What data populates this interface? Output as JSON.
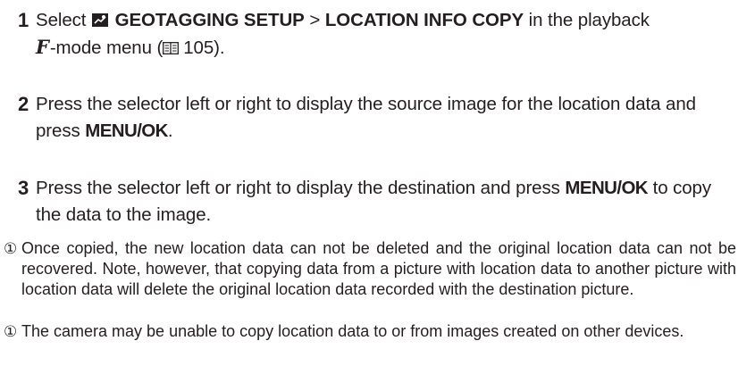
{
  "steps": [
    {
      "number": "1",
      "pre": "Select",
      "menu_item_1": "GEOTAGGING SETUP",
      "separator": ">",
      "menu_item_2": "LOCATION INFO COPY",
      "mid": "in the playback",
      "mode_glyph": "F",
      "post": "-mode menu (",
      "page_ref": "105",
      "close": ")."
    },
    {
      "number": "2",
      "text": "Press the selector left or right to display the source image for the location data and press",
      "button": "MENU/OK",
      "end": "."
    },
    {
      "number": "3",
      "text": "Press the selector left or right to display the destination and press",
      "button": "MENU/OK",
      "text_after": "to copy the data to the image."
    }
  ],
  "notes": [
    {
      "icon": "caution-icon",
      "glyph": "①",
      "text": "Once copied, the new location data can not be deleted and the original location data can not be recovered.  Note, however, that copying data from a picture with location data to another picture with location data will delete the original location data recorded with the destination picture."
    },
    {
      "icon": "caution-icon",
      "glyph": "①",
      "text": "The camera may be unable to copy location data to or from images created on other devices."
    }
  ]
}
